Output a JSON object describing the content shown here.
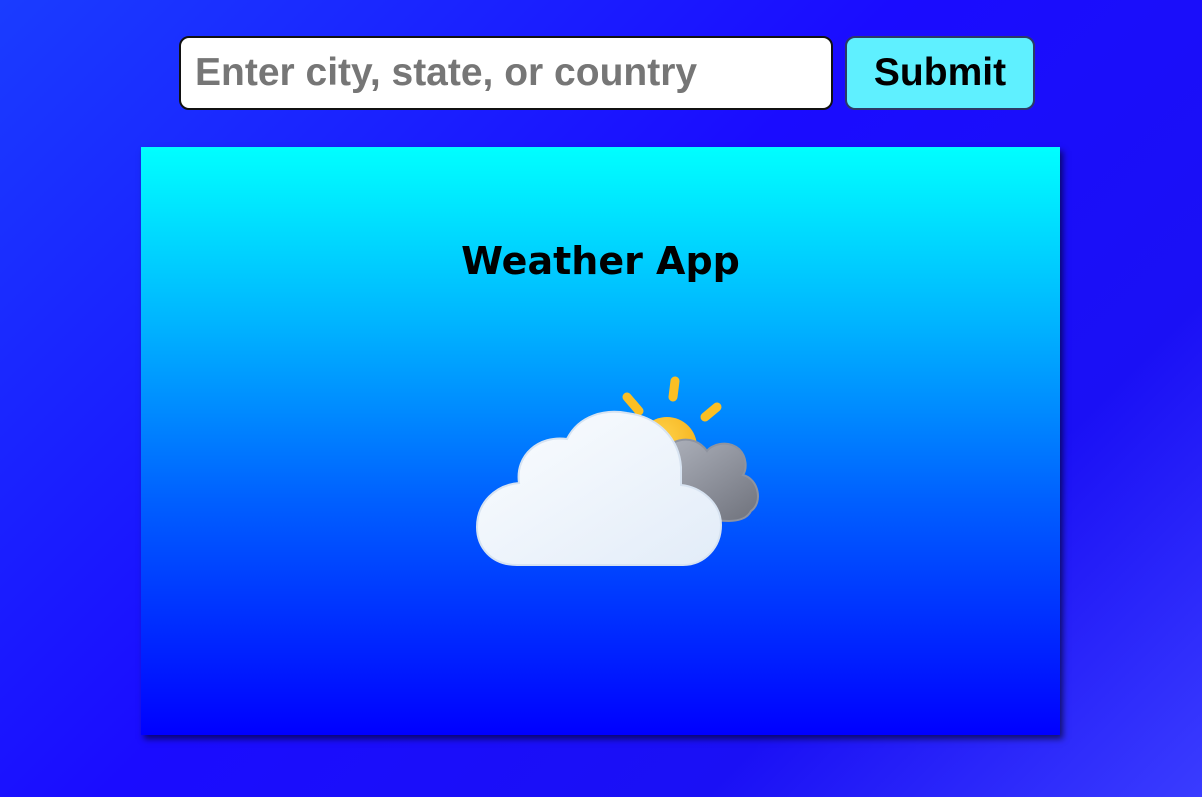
{
  "search": {
    "placeholder": "Enter city, state, or country",
    "value": ""
  },
  "submit_label": "Submit",
  "card": {
    "title": "Weather App",
    "icon": "partly-cloudy-icon"
  },
  "colors": {
    "background": "#1a10ff",
    "submit_button": "#5ff0ff",
    "card_top": "#00ffff",
    "card_bottom": "#0000ff",
    "sun": "#fbbf24"
  }
}
